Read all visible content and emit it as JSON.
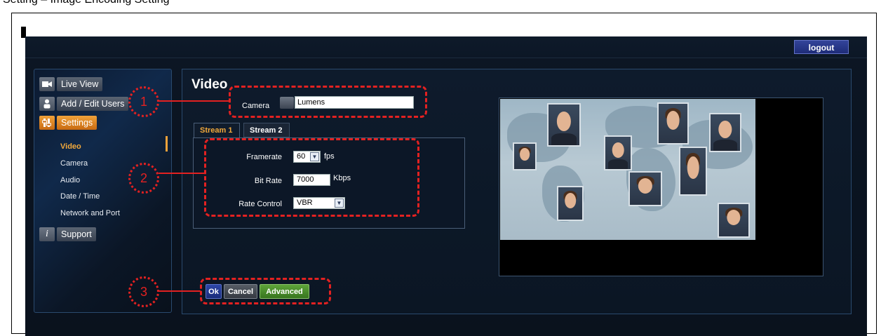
{
  "document": {
    "heading": "Setting – Image Encoding Setting"
  },
  "header": {
    "logout_label": "logout"
  },
  "sidebar": {
    "items": [
      {
        "label": "Live View",
        "icon": "camera-icon"
      },
      {
        "label": "Add / Edit Users",
        "icon": "users-icon"
      },
      {
        "label": "Settings",
        "icon": "settings-icon"
      }
    ],
    "sub_items": [
      {
        "label": "Video"
      },
      {
        "label": "Camera"
      },
      {
        "label": "Audio"
      },
      {
        "label": "Date / Time"
      },
      {
        "label": "Network and Port"
      }
    ],
    "support": {
      "label": "Support",
      "icon": "info-icon"
    }
  },
  "main": {
    "title": "Video",
    "camera_label": "Camera",
    "camera_value": "Lumens",
    "tabs": [
      {
        "label": "Stream 1"
      },
      {
        "label": "Stream 2"
      }
    ],
    "framerate": {
      "label": "Framerate",
      "value": "60",
      "unit": "fps"
    },
    "bitrate": {
      "label": "Bit Rate",
      "value": "7000",
      "unit": "Kbps"
    },
    "rate_control": {
      "label": "Rate Control",
      "value": "VBR"
    }
  },
  "buttons": {
    "ok": "Ok",
    "cancel": "Cancel",
    "advanced": "Advanced"
  },
  "annotations": {
    "one": "1",
    "two": "2",
    "three": "3"
  },
  "colors": {
    "accent": "#f0a23a",
    "annotation": "#e32121",
    "ok": "#1a2c7a",
    "advanced": "#37751e"
  }
}
